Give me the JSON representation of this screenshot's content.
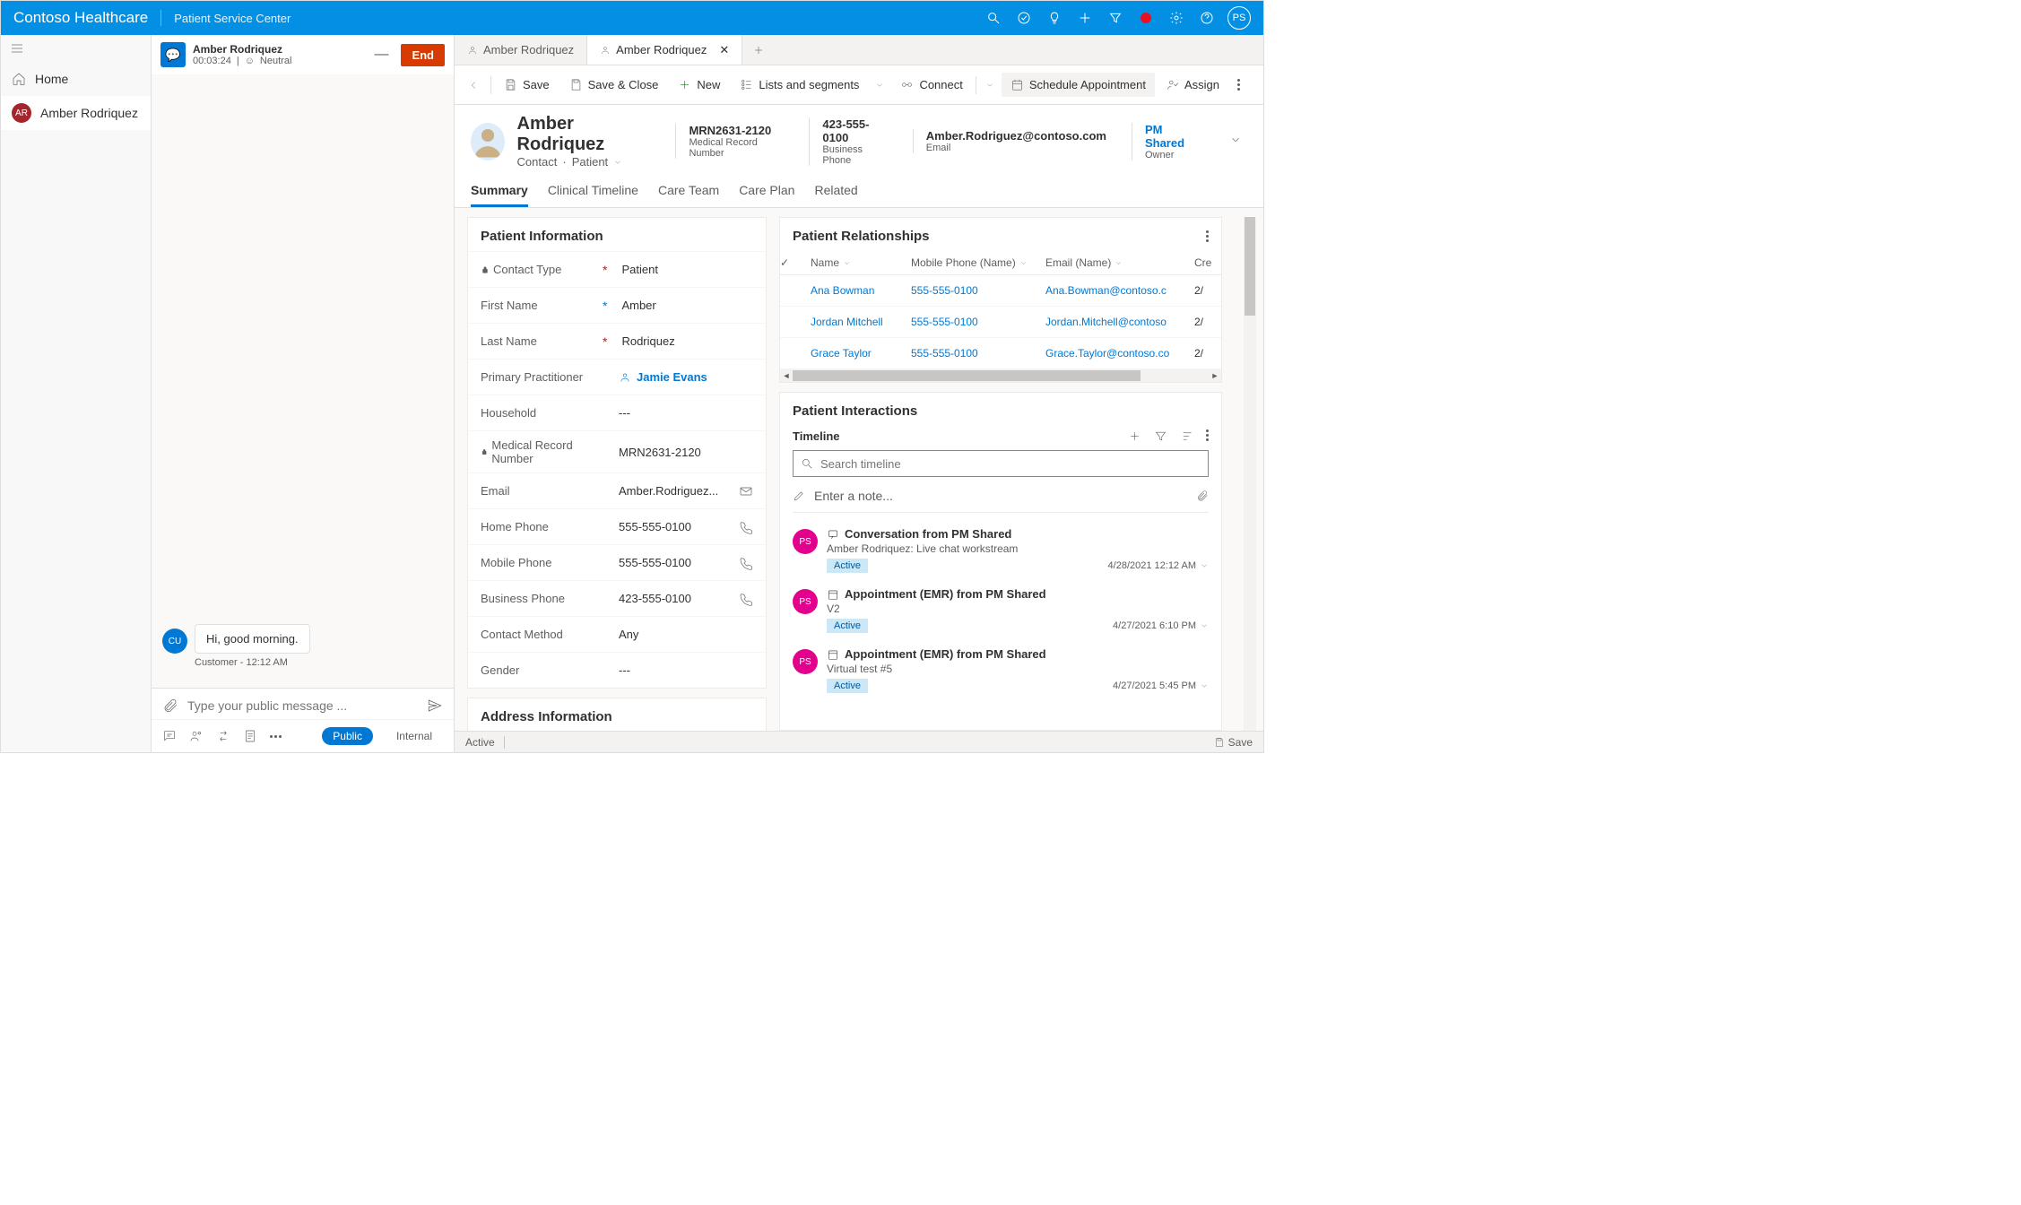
{
  "topbar": {
    "brand": "Contoso Healthcare",
    "subtitle": "Patient Service Center",
    "avatar": "PS"
  },
  "leftnav": {
    "home": "Home",
    "patient": "Amber Rodriquez",
    "patient_initials": "AR"
  },
  "chat": {
    "name": "Amber Rodriquez",
    "timer": "00:03:24",
    "sentiment": "Neutral",
    "end": "End",
    "message": "Hi, good morning.",
    "message_meta": "Customer - 12:12 AM",
    "cu": "CU",
    "input_placeholder": "Type your public message ...",
    "public": "Public",
    "internal": "Internal"
  },
  "tabs": {
    "t1": "Amber Rodriquez",
    "t2": "Amber Rodriquez"
  },
  "commands": {
    "save": "Save",
    "save_close": "Save & Close",
    "new": "New",
    "lists": "Lists and segments",
    "connect": "Connect",
    "schedule": "Schedule Appointment",
    "assign": "Assign"
  },
  "header": {
    "name": "Amber Rodriquez",
    "entity": "Contact",
    "form": "Patient",
    "mrn": {
      "v": "MRN2631-2120",
      "k": "Medical Record Number"
    },
    "phone": {
      "v": "423-555-0100",
      "k": "Business Phone"
    },
    "email": {
      "v": "Amber.Rodriguez@contoso.com",
      "k": "Email"
    },
    "owner": {
      "v": "PM Shared",
      "k": "Owner"
    }
  },
  "formtabs": {
    "summary": "Summary",
    "clinical": "Clinical Timeline",
    "care_team": "Care Team",
    "care_plan": "Care Plan",
    "related": "Related"
  },
  "patient_info": {
    "title": "Patient Information",
    "contact_type": {
      "label": "Contact Type",
      "value": "Patient"
    },
    "first_name": {
      "label": "First Name",
      "value": "Amber"
    },
    "last_name": {
      "label": "Last Name",
      "value": "Rodriquez"
    },
    "primary_practitioner": {
      "label": "Primary Practitioner",
      "value": "Jamie Evans"
    },
    "household": {
      "label": "Household",
      "value": "---"
    },
    "mrn": {
      "label": "Medical Record Number",
      "value": "MRN2631-2120"
    },
    "email": {
      "label": "Email",
      "value": "Amber.Rodriguez..."
    },
    "home_phone": {
      "label": "Home Phone",
      "value": "555-555-0100"
    },
    "mobile_phone": {
      "label": "Mobile Phone",
      "value": "555-555-0100"
    },
    "business_phone": {
      "label": "Business Phone",
      "value": "423-555-0100"
    },
    "contact_method": {
      "label": "Contact Method",
      "value": "Any"
    },
    "gender": {
      "label": "Gender",
      "value": "---"
    }
  },
  "address_info": {
    "title": "Address Information"
  },
  "relationships": {
    "title": "Patient Relationships",
    "cols": {
      "name": "Name",
      "mobile": "Mobile Phone (Name)",
      "email": "Email (Name)",
      "created": "Cre"
    },
    "rows": [
      {
        "name": "Ana Bowman",
        "mobile": "555-555-0100",
        "email": "Ana.Bowman@contoso.c",
        "cr": "2/"
      },
      {
        "name": "Jordan Mitchell",
        "mobile": "555-555-0100",
        "email": "Jordan.Mitchell@contoso",
        "cr": "2/"
      },
      {
        "name": "Grace Taylor",
        "mobile": "555-555-0100",
        "email": "Grace.Taylor@contoso.co",
        "cr": "2/"
      }
    ]
  },
  "interactions": {
    "title": "Patient Interactions",
    "timeline": "Timeline",
    "search_placeholder": "Search timeline",
    "note_placeholder": "Enter a note...",
    "items": [
      {
        "title": "Conversation from PM Shared",
        "sub": "Amber Rodriquez: Live chat workstream",
        "badge": "Active",
        "ts": "4/28/2021 12:12 AM"
      },
      {
        "title": "Appointment (EMR) from PM Shared",
        "sub": "V2",
        "badge": "Active",
        "ts": "4/27/2021 6:10 PM"
      },
      {
        "title": "Appointment (EMR) from PM Shared",
        "sub": "Virtual test #5",
        "badge": "Active",
        "ts": "4/27/2021 5:45 PM"
      }
    ],
    "ps": "PS"
  },
  "status": {
    "active": "Active",
    "save": "Save"
  }
}
